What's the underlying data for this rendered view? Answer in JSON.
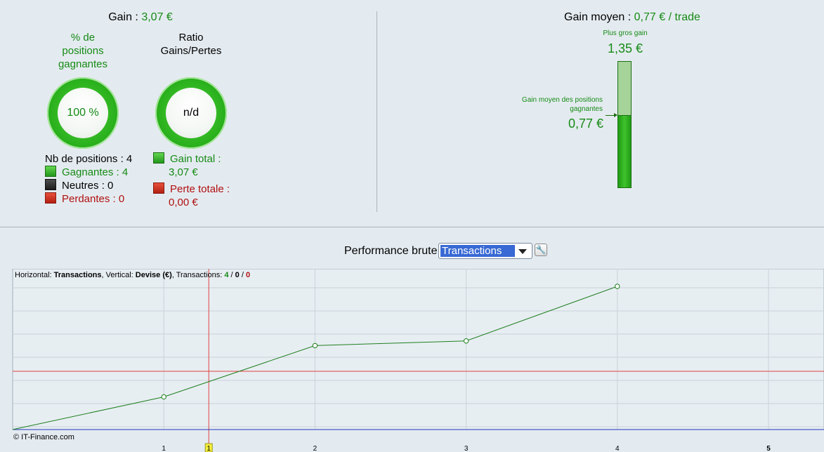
{
  "summary": {
    "gain_label": "Gain : ",
    "gain_value": "3,07 €",
    "pct_title_1": "% de",
    "pct_title_2": "positions",
    "pct_title_3": "gagnantes",
    "pct_value": "100 %",
    "ratio_title_1": "Ratio",
    "ratio_title_2": "Gains/Pertes",
    "ratio_value": "n/d",
    "nb_positions": "Nb de positions : 4",
    "gagnantes": "Gagnantes : 4",
    "neutres": "Neutres : 0",
    "perdantes": "Perdantes : 0",
    "gain_total_label": "Gain total :",
    "gain_total_value": "3,07 €",
    "perte_totale_label": "Perte totale :",
    "perte_totale_value": "0,00 €"
  },
  "gauge": {
    "avg_label": "Gain moyen : ",
    "avg_value": "0,77 € / trade",
    "max_caption": "Plus gros gain",
    "max_value": "1,35 €",
    "avg_caption_1": "Gain moyen des positions",
    "avg_caption_2": "gagnantes",
    "avg_caption_value": "0,77 €",
    "fill_fraction": 0.57
  },
  "toolbar": {
    "label": "Performance brute",
    "selected": "Transactions"
  },
  "chart_info": {
    "h_prefix": "Horizontal: ",
    "h_value": "Transactions",
    "v_prefix": ", Vertical: ",
    "v_value": "Devise (€)",
    "t_prefix": ", Transactions: ",
    "t_win": "4",
    "sep1": " / ",
    "t_neutral": "0",
    "sep2": " / ",
    "t_loss": "0"
  },
  "copyright": "© IT-Finance.com",
  "colors": {
    "green": "#168a16",
    "red": "#b01010",
    "line": "#1f7f1f",
    "zero_line": "#2233bb",
    "ref_line": "#e04040"
  },
  "chart_data": {
    "type": "line",
    "x": [
      0,
      1,
      2,
      3,
      4
    ],
    "y": [
      0,
      0.7,
      1.8,
      1.9,
      3.07
    ],
    "xticks": [
      "1",
      "2",
      "3",
      "4",
      "5"
    ],
    "highlight_tick": "1",
    "xlim": [
      0,
      5.1
    ],
    "ylim": [
      0,
      3.07
    ],
    "reference_x": 0.3,
    "reference_y": 1.25,
    "grid": true
  }
}
